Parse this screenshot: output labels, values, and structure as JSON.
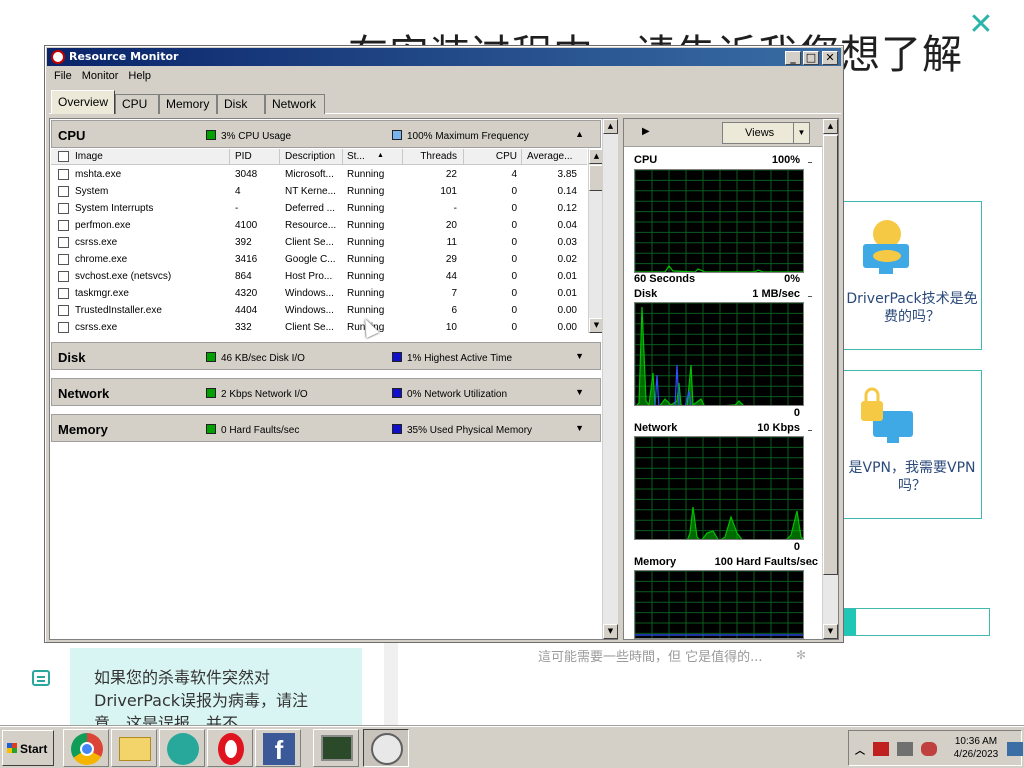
{
  "background": {
    "heading": "在安装过程中，请告诉我您想了解",
    "close_glyph": "✕",
    "cards": [
      {
        "label": "DriverPack技术是免费的吗？"
      },
      {
        "label": "是VPN，我需要VPN吗？"
      }
    ],
    "progress_fraction": 0.09,
    "waiting_text": "這可能需要一些時間，但 它是值得的...",
    "tip_text": "如果您的杀毒软件突然对DriverPack误报为病毒，请注意，这是误报，并不"
  },
  "window": {
    "title": "Resource Monitor",
    "controls": {
      "minimize": "_",
      "maximize": "□",
      "close": "✕"
    },
    "menu": [
      "File",
      "Monitor",
      "Help"
    ],
    "tabs": [
      "Overview",
      "CPU",
      "Memory",
      "Disk",
      "Network"
    ],
    "active_tab": "Overview"
  },
  "cpu_section": {
    "name": "CPU",
    "stat1": "3% CPU Usage",
    "stat2": "100% Maximum Frequency",
    "columns": [
      "Image",
      "PID",
      "Description",
      "St...",
      "Threads",
      "CPU",
      "Average..."
    ],
    "rows": [
      {
        "image": "mshta.exe",
        "pid": "3048",
        "desc": "Microsoft...",
        "status": "Running",
        "threads": "22",
        "cpu": "4",
        "avg": "3.85"
      },
      {
        "image": "System",
        "pid": "4",
        "desc": "NT Kerne...",
        "status": "Running",
        "threads": "101",
        "cpu": "0",
        "avg": "0.14"
      },
      {
        "image": "System Interrupts",
        "pid": "-",
        "desc": "Deferred ...",
        "status": "Running",
        "threads": "-",
        "cpu": "0",
        "avg": "0.12"
      },
      {
        "image": "perfmon.exe",
        "pid": "4100",
        "desc": "Resource...",
        "status": "Running",
        "threads": "20",
        "cpu": "0",
        "avg": "0.04"
      },
      {
        "image": "csrss.exe",
        "pid": "392",
        "desc": "Client Se...",
        "status": "Running",
        "threads": "11",
        "cpu": "0",
        "avg": "0.03"
      },
      {
        "image": "chrome.exe",
        "pid": "3416",
        "desc": "Google C...",
        "status": "Running",
        "threads": "29",
        "cpu": "0",
        "avg": "0.02"
      },
      {
        "image": "svchost.exe (netsvcs)",
        "pid": "864",
        "desc": "Host Pro...",
        "status": "Running",
        "threads": "44",
        "cpu": "0",
        "avg": "0.01"
      },
      {
        "image": "taskmgr.exe",
        "pid": "4320",
        "desc": "Windows...",
        "status": "Running",
        "threads": "7",
        "cpu": "0",
        "avg": "0.01"
      },
      {
        "image": "TrustedInstaller.exe",
        "pid": "4404",
        "desc": "Windows...",
        "status": "Running",
        "threads": "6",
        "cpu": "0",
        "avg": "0.00"
      },
      {
        "image": "csrss.exe",
        "pid": "332",
        "desc": "Client Se...",
        "status": "Running",
        "threads": "10",
        "cpu": "0",
        "avg": "0.00"
      }
    ]
  },
  "sections": [
    {
      "name": "Disk",
      "stat1": "46 KB/sec Disk I/O",
      "stat2": "1% Highest Active Time"
    },
    {
      "name": "Network",
      "stat1": "2 Kbps Network I/O",
      "stat2": "0% Network Utilization"
    },
    {
      "name": "Memory",
      "stat1": "0 Hard Faults/sec",
      "stat2": "35% Used Physical Memory"
    }
  ],
  "right_pane": {
    "views_label": "Views",
    "graphs": [
      {
        "label": "CPU",
        "max": "100%",
        "min_label": "60 Seconds",
        "min": "0%"
      },
      {
        "label": "Disk",
        "max": "1 MB/sec",
        "min_label": "",
        "min": "0"
      },
      {
        "label": "Network",
        "max": "10 Kbps",
        "min_label": "",
        "min": "0"
      },
      {
        "label": "Memory",
        "max": "100 Hard Faults/sec",
        "min_label": "",
        "min": ""
      }
    ]
  },
  "colors": {
    "accent": "#40b8ae",
    "graph_green": "#00c000",
    "graph_blue": "#3050ff",
    "title_bar": "#0a246a"
  },
  "taskbar": {
    "start_label": "Start",
    "apps": [
      "chrome-icon",
      "explorer-icon",
      "driverpack-icon",
      "opera-icon",
      "facebook-icon",
      "resource-monitor-icon",
      "perfmon-icon"
    ],
    "time": "10:36 AM",
    "date": "4/26/2023"
  }
}
